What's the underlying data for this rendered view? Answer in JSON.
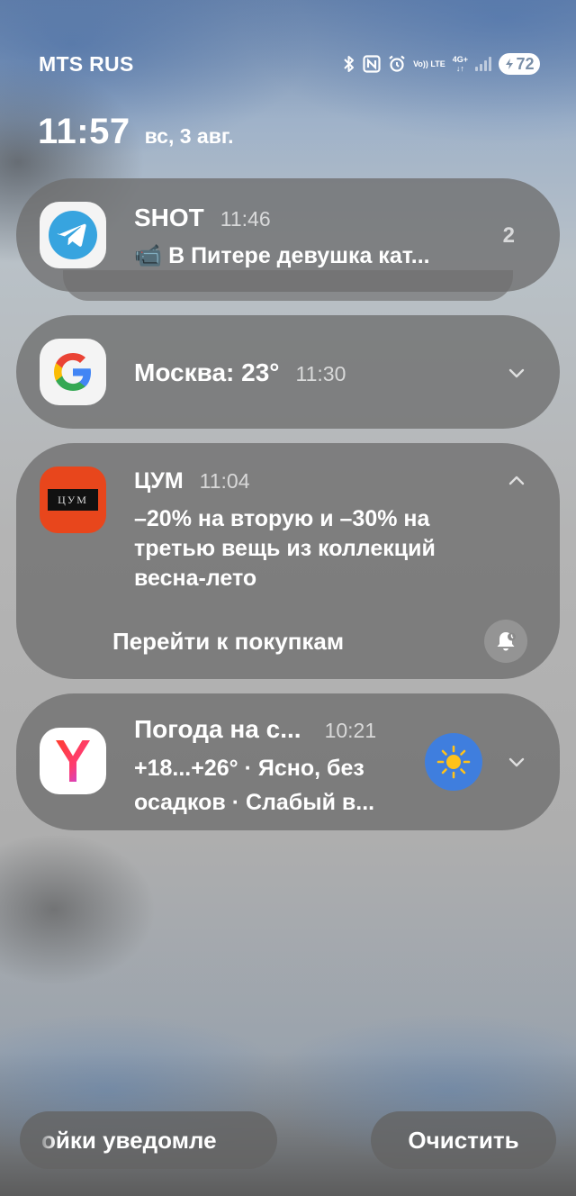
{
  "status_bar": {
    "carrier": "MTS RUS",
    "volte": "Vo)) LTE",
    "network": "4G+",
    "battery": "72",
    "icons": [
      "bluetooth-icon",
      "nfc-icon",
      "alarm-icon",
      "volte-icon",
      "network-4g-icon",
      "signal-icon",
      "battery-icon"
    ]
  },
  "lockscreen": {
    "time": "11:57",
    "date": "вс, 3 авг."
  },
  "notifications": [
    {
      "app": "telegram",
      "icon": "telegram-icon",
      "title": "SHOT",
      "time": "11:46",
      "body": "📹 В Питере девушка кат...",
      "count": "2",
      "color": "#37a4df"
    },
    {
      "app": "google",
      "icon": "google-icon",
      "title": "Москва: 23°",
      "time": "11:30"
    },
    {
      "app": "tsum",
      "icon": "tsum-logo-icon",
      "title": "ЦУМ",
      "time": "11:04",
      "logo_text": "ЦУМ",
      "body_lines": [
        "–20% на вторую и –30% на",
        "третью вещь из коллекций",
        "весна-лето"
      ],
      "action": "Перейти к покупкам",
      "color": "#e8461c"
    },
    {
      "app": "yandex",
      "icon": "yandex-icon",
      "title": "Погода на с...",
      "time": "10:21",
      "body_lines": [
        "+18...+26° · Ясно, без",
        "осадков · Слабый в..."
      ],
      "weather_icon": "sun-icon",
      "color": "#ff3d2e"
    }
  ],
  "bottom": {
    "settings_label": "ойки уведомле",
    "clear_label": "Очистить"
  }
}
